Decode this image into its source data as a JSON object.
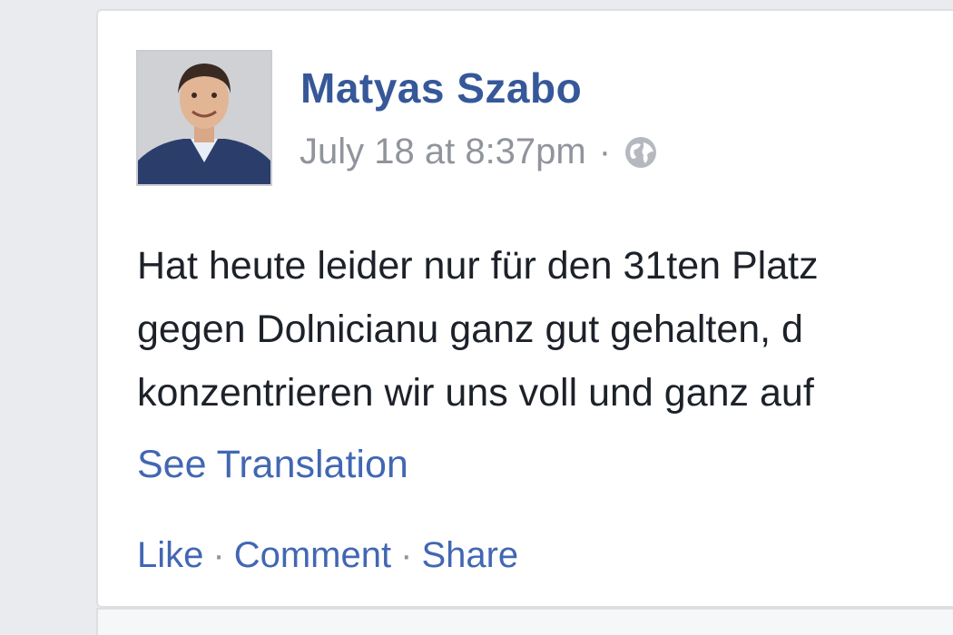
{
  "post": {
    "author": "Matyas Szabo",
    "timestamp": "July 18 at 8:37pm",
    "separator": "·",
    "privacy_icon": "globe-icon",
    "text_lines": [
      "Hat heute leider nur für den 31ten Platz",
      "gegen Dolnicianu ganz gut gehalten, d",
      "konzentrieren wir uns voll und ganz auf"
    ],
    "see_translation": "See Translation",
    "actions": {
      "like": "Like",
      "comment": "Comment",
      "share": "Share",
      "separator": "·"
    }
  },
  "colors": {
    "link_blue": "#4267b2",
    "name_blue": "#365899",
    "meta_gray": "#90949c",
    "text": "#1d2129",
    "page_bg": "#e9ebee"
  }
}
